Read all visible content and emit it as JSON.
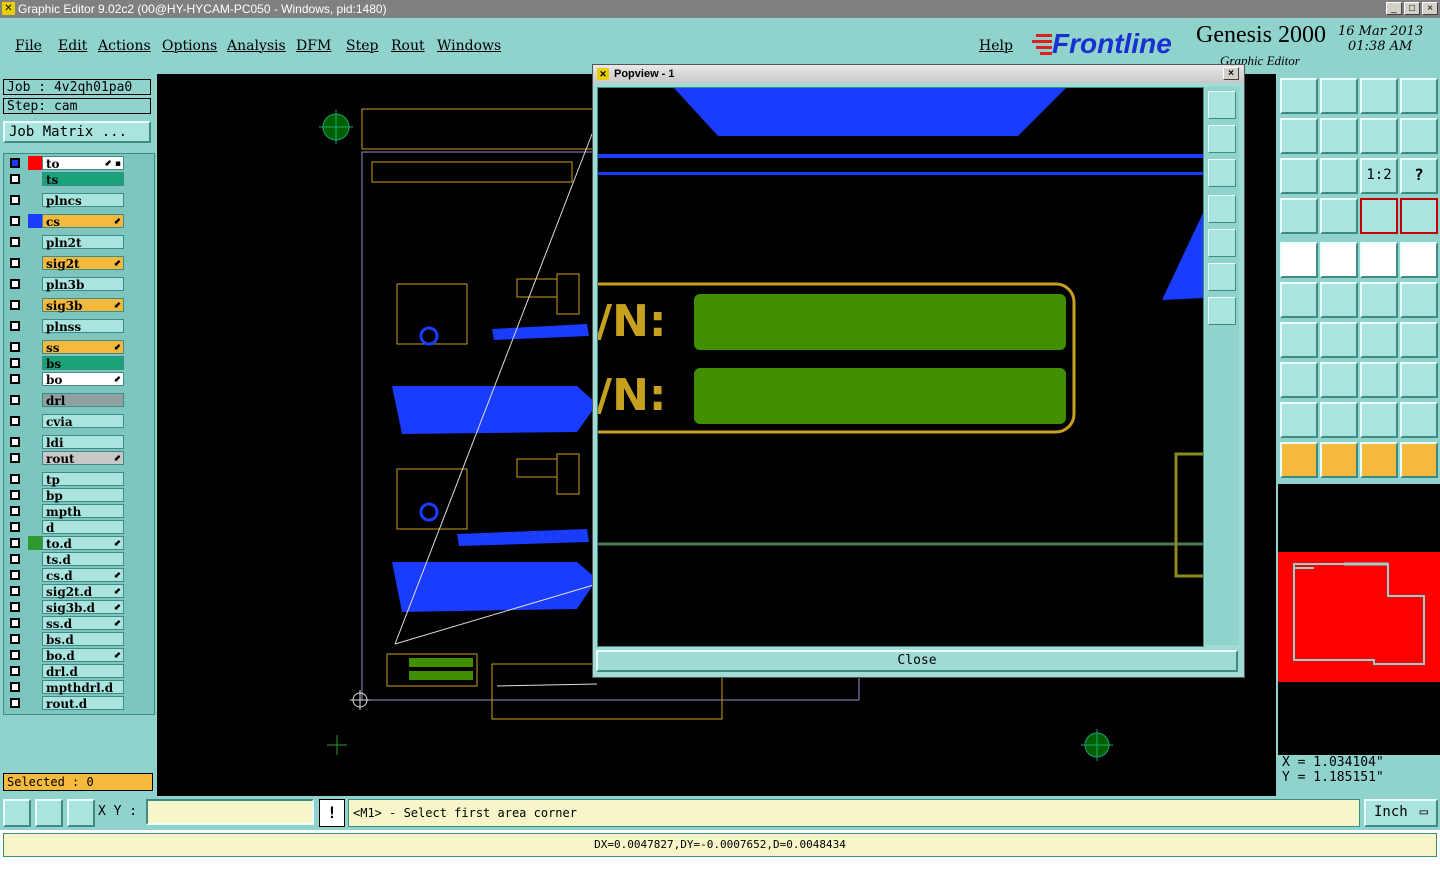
{
  "window": {
    "title": "Graphic Editor 9.02c2 (00@HY-HYCAM-PC050 - Windows, pid:1480)",
    "minimize": "_",
    "maximize": "□",
    "close": "×"
  },
  "menu": {
    "file": "File",
    "edit": "Edit",
    "actions": "Actions",
    "options": "Options",
    "analysis": "Analysis",
    "dfm": "DFM",
    "step": "Step",
    "rout": "Rout",
    "windows": "Windows",
    "help": "Help"
  },
  "brand": {
    "company": "Frontline",
    "product": "Genesis 2000",
    "subtitle": "Graphic Editor",
    "date": "16 Mar 2013",
    "time": "01:38 AM"
  },
  "left": {
    "job": "Job : 4v2qh01pa0",
    "step": "Step: cam",
    "job_matrix": "Job Matrix ...",
    "selected": "Selected : 0",
    "layers": [
      {
        "name": "to",
        "bg": "#ffffff",
        "color": "#ff0000",
        "arrow": "⬋ ▪",
        "checked": true
      },
      {
        "name": "ts",
        "bg": "#1aa37a",
        "color": "",
        "arrow": ""
      },
      {
        "name": "plncs",
        "bg": "#a9e4de",
        "color": "",
        "arrow": ""
      },
      {
        "name": "cs",
        "bg": "#f5b93e",
        "color": "#1a3cff",
        "arrow": "⬋"
      },
      {
        "name": "pln2t",
        "bg": "#a9e4de",
        "color": "",
        "arrow": ""
      },
      {
        "name": "sig2t",
        "bg": "#f5b93e",
        "color": "",
        "arrow": "⬋"
      },
      {
        "name": "pln3b",
        "bg": "#a9e4de",
        "color": "",
        "arrow": ""
      },
      {
        "name": "sig3b",
        "bg": "#f5b93e",
        "color": "",
        "arrow": "⬋"
      },
      {
        "name": "plnss",
        "bg": "#a9e4de",
        "color": "",
        "arrow": ""
      },
      {
        "name": "ss",
        "bg": "#f5b93e",
        "color": "",
        "arrow": "⬋"
      },
      {
        "name": "bs",
        "bg": "#1aa37a",
        "color": "",
        "arrow": ""
      },
      {
        "name": "bo",
        "bg": "#ffffff",
        "color": "",
        "arrow": "⬋"
      },
      {
        "name": "drl",
        "bg": "#8fa0a0",
        "color": "",
        "arrow": ""
      },
      {
        "name": "cvia",
        "bg": "#a9e4de",
        "color": "",
        "arrow": ""
      },
      {
        "name": "ldi",
        "bg": "#a9e4de",
        "color": "",
        "arrow": ""
      },
      {
        "name": "rout",
        "bg": "#c8c8c8",
        "color": "",
        "arrow": "⬋"
      },
      {
        "name": "tp",
        "bg": "#a9e4de",
        "color": "",
        "arrow": ""
      },
      {
        "name": "bp",
        "bg": "#a9e4de",
        "color": "",
        "arrow": ""
      },
      {
        "name": "mpth",
        "bg": "#a9e4de",
        "color": "",
        "arrow": ""
      },
      {
        "name": "d",
        "bg": "#a9e4de",
        "color": "",
        "arrow": ""
      },
      {
        "name": "to.d",
        "bg": "#a9e4de",
        "color": "#2e9a2e",
        "arrow": "⬋"
      },
      {
        "name": "ts.d",
        "bg": "#a9e4de",
        "color": "",
        "arrow": ""
      },
      {
        "name": "cs.d",
        "bg": "#a9e4de",
        "color": "",
        "arrow": "⬋"
      },
      {
        "name": "sig2t.d",
        "bg": "#a9e4de",
        "color": "",
        "arrow": "⬋"
      },
      {
        "name": "sig3b.d",
        "bg": "#a9e4de",
        "color": "",
        "arrow": "⬋"
      },
      {
        "name": "ss.d",
        "bg": "#a9e4de",
        "color": "",
        "arrow": "⬋"
      },
      {
        "name": "bs.d",
        "bg": "#a9e4de",
        "color": "",
        "arrow": ""
      },
      {
        "name": "bo.d",
        "bg": "#a9e4de",
        "color": "",
        "arrow": "⬋"
      },
      {
        "name": "drl.d",
        "bg": "#a9e4de",
        "color": "",
        "arrow": ""
      },
      {
        "name": "mpthdrl.d",
        "bg": "#a9e4de",
        "color": "",
        "arrow": ""
      },
      {
        "name": "rout.d",
        "bg": "#a9e4de",
        "color": "",
        "arrow": ""
      }
    ]
  },
  "popview": {
    "title": "Popview - 1",
    "close_label": "Close",
    "label_line1": "/N:",
    "label_line2": "/N:"
  },
  "right": {
    "coord_x": "X = 1.034104\"",
    "coord_y": "Y = 1.185151\"",
    "ratio_label": "1:2",
    "help_label": "?"
  },
  "bottom": {
    "xy_label": "X Y :",
    "xy_value": "",
    "warn": "!",
    "prompt": "<M1> - Select first area corner",
    "unit": "Inch",
    "measure": "DX=0.0047827,DY=-0.0007652,D=0.0048434"
  },
  "colors": {
    "panel": "#8fd3cc",
    "orange": "#f5b93e",
    "teal": "#1aa37a",
    "copper_blue": "#1a3cff",
    "silk_gold": "#c8a020",
    "pad_green": "#3f8f00"
  }
}
